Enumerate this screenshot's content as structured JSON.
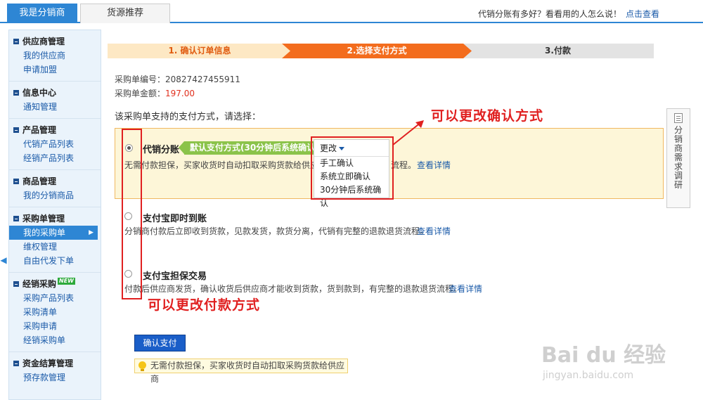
{
  "tabs": {
    "active": "我是分销商",
    "other": "货源推荐"
  },
  "top_right": {
    "text": "代销分账有多好？看看用的人怎么说！",
    "link": "点击查看"
  },
  "sidebar": {
    "groups": [
      {
        "title": "供应商管理",
        "items": [
          "我的供应商",
          "申请加盟"
        ]
      },
      {
        "title": "信息中心",
        "items": [
          "通知管理"
        ]
      },
      {
        "title": "产品管理",
        "items": [
          "代销产品列表",
          "经销产品列表"
        ]
      },
      {
        "title": "商品管理",
        "items": [
          "我的分销商品"
        ]
      },
      {
        "title": "采购单管理",
        "items": [
          "我的采购单",
          "维权管理",
          "自由代发下单"
        ]
      },
      {
        "title": "经销采购",
        "badge": "NEW",
        "items": [
          "采购产品列表",
          "采购清单",
          "采购申请",
          "经销采购单"
        ]
      },
      {
        "title": "资金结算管理",
        "items": [
          "预存款管理"
        ]
      }
    ]
  },
  "steps": [
    "1. 确认订单信息",
    "2.选择支付方式",
    "3.付款"
  ],
  "order": {
    "number_label": "采购单编号：",
    "number": "20827427455911",
    "amount_label": "采购单金额：",
    "amount": "197.00"
  },
  "prompt": "该采购单支持的支付方式，请选择：",
  "payment_options": [
    {
      "title": "代销分账",
      "tag": "默认支付方式(30分钟后系统确认)",
      "desc": "无需付款担保，买家收货时自动扣取采购货款给供应商",
      "desc_tail": "流程。",
      "link": "查看详情",
      "checked": true
    },
    {
      "title": "支付宝即时到账",
      "desc": "分销商付款后立即收到货款，见款发货，款货分离，代销有完整的退款退货流程。",
      "link": "查看详情",
      "checked": false
    },
    {
      "title": "支付宝担保交易",
      "desc": "付款后供应商发货，确认收货后供应商才能收到货款，货到款到，有完整的退款退货流程。",
      "link": "查看详情",
      "checked": false
    }
  ],
  "dropdown": {
    "head": "更改",
    "options": [
      "手工确认",
      "系统立即确认",
      "30分钟后系统确认"
    ]
  },
  "annotations": {
    "confirm_method": "可以更改确认方式",
    "payment_method": "可以更改付款方式"
  },
  "survey": "分销商需求调研",
  "confirm_button": "确认支付",
  "tip": "无需付款担保，买家收货时自动扣取采购货款给供应商",
  "watermark": {
    "logo": "Bai du 经验",
    "url": "jingyan.baidu.com"
  },
  "colors": {
    "accent": "#2e86d4",
    "step_active": "#f36c1d",
    "annotation": "#e02020"
  }
}
